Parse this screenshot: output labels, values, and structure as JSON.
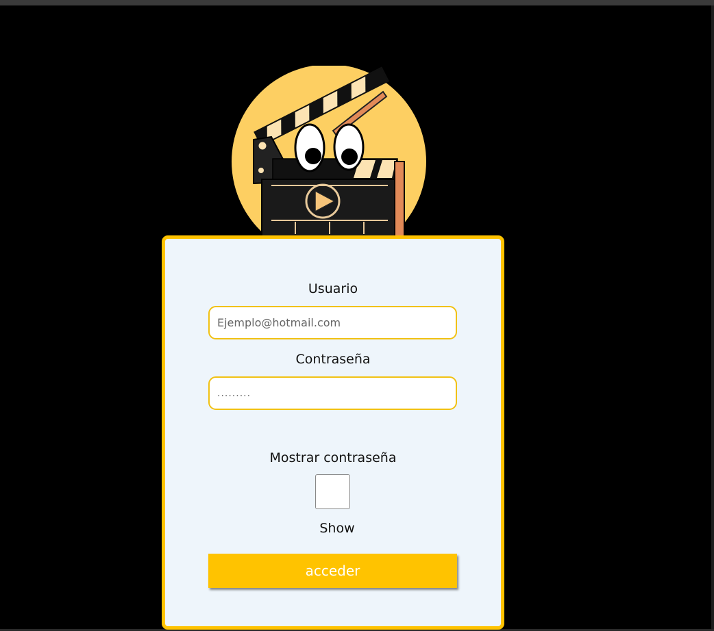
{
  "login": {
    "user_label": "Usuario",
    "user_placeholder": "Ejemplo@hotmail.com",
    "password_label": "Contraseña",
    "password_placeholder": ".........",
    "show_password_label": "Mostrar contraseña",
    "show_checkbox_caption": "Show",
    "submit_label": "acceder"
  },
  "colors": {
    "background": "#000000",
    "accent": "#ffc300",
    "card_bg": "#eef5fb",
    "logo_circle": "#fdcf62"
  }
}
